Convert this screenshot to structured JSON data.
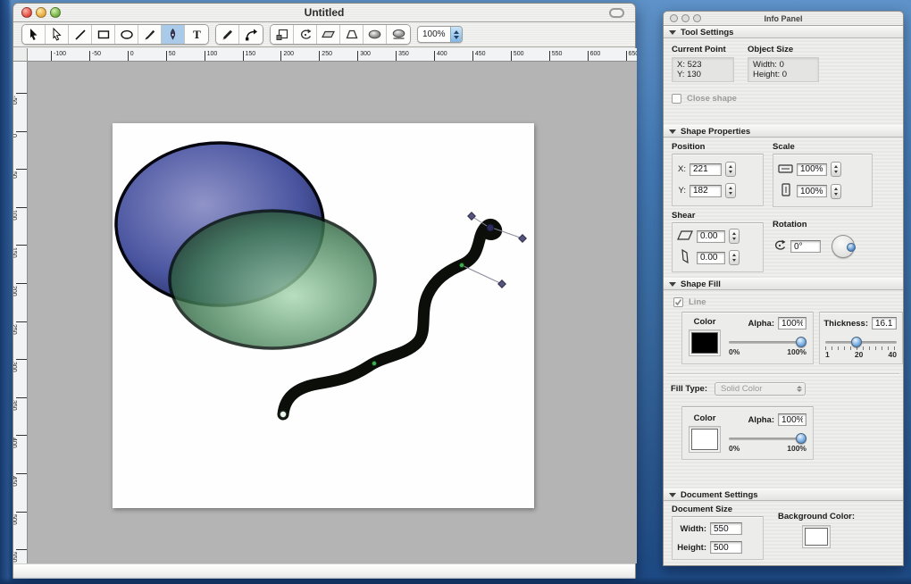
{
  "main_window": {
    "title": "Untitled",
    "toolbar": {
      "zoom_value": "100%",
      "selected_tool": "pen-tool",
      "tools_group_1": [
        "selection-tool",
        "direct-selection-tool",
        "line-tool",
        "rectangle-tool",
        "ellipse-tool",
        "brush-tool",
        "pen-tool",
        "text-tool"
      ],
      "tools_group_2": [
        "pencil-tool",
        "convert-point-tool"
      ],
      "tools_group_3": [
        "scale-tool",
        "rotate-tool",
        "shear-tool",
        "distort-tool",
        "gradient-tool",
        "envelope-tool"
      ]
    },
    "ruler_h": {
      "labels": [
        "-100",
        "-50",
        "0",
        "50",
        "100",
        "150",
        "200",
        "250",
        "300",
        "350",
        "400",
        "450",
        "500",
        "550",
        "600",
        "650"
      ]
    },
    "ruler_v": {
      "labels": [
        "-50",
        "0",
        "50",
        "100",
        "150",
        "200",
        "250",
        "300",
        "350",
        "400",
        "450",
        "500",
        "550"
      ]
    }
  },
  "canvas": {
    "page_background": "#fefefe",
    "work_area_background": "#b4b4b4",
    "blue_ellipse": {
      "center": "#9094c8",
      "mid": "#4a55a0",
      "edge": "#1d2550",
      "outline": "#05050e"
    },
    "green_ellipse": {
      "center": "#a9d9b2",
      "mid": "#3f7a52",
      "edge": "#122a18",
      "outline": "#05110a",
      "opacity": 0.82
    },
    "squiggle": {
      "color": "#0b0e09",
      "thickness": 13
    },
    "anchor_green": "#3fae4f",
    "handle_purple": "#54547e"
  },
  "info_panel": {
    "title": "Info Panel",
    "tool_settings": {
      "header": "Tool Settings",
      "current_point": {
        "label": "Current Point",
        "x_label": "X:",
        "x_value": "523",
        "y_label": "Y:",
        "y_value": "130"
      },
      "object_size": {
        "label": "Object Size",
        "w_label": "Width:",
        "w_value": "0",
        "h_label": "Height:",
        "h_value": "0"
      },
      "close_shape_label": "Close shape"
    },
    "shape_properties": {
      "header": "Shape Properties",
      "position": {
        "label": "Position",
        "x_label": "X:",
        "x_value": "221",
        "y_label": "Y:",
        "y_value": "182"
      },
      "scale": {
        "label": "Scale",
        "h_value": "100%",
        "v_value": "100%"
      },
      "shear": {
        "label": "Shear",
        "h_value": "0.00",
        "v_value": "0.00"
      },
      "rotation": {
        "label": "Rotation",
        "value": "0°"
      }
    },
    "shape_fill": {
      "header": "Shape Fill",
      "line": {
        "checkbox_label": "Line",
        "color_label": "Color",
        "color_value": "#000000",
        "alpha_label": "Alpha:",
        "alpha_value": "100%",
        "alpha_min": "0%",
        "alpha_max": "100%",
        "thickness_label": "Thickness:",
        "thickness_value": "16.1",
        "thickness_min": "1",
        "thickness_mid": "20",
        "thickness_max": "40"
      },
      "fill_type": {
        "label": "Fill Type:",
        "value": "Solid Color"
      },
      "fill": {
        "color_label": "Color",
        "color_value": "#ffffff",
        "alpha_label": "Alpha:",
        "alpha_value": "100%",
        "alpha_min": "0%",
        "alpha_max": "100%"
      }
    },
    "document_settings": {
      "header": "Document Settings",
      "document_size": {
        "label": "Document Size",
        "w_label": "Width:",
        "w_value": "550",
        "h_label": "Height:",
        "h_value": "500"
      },
      "background_color_label": "Background Color:",
      "background_color_value": "#ffffff"
    }
  }
}
